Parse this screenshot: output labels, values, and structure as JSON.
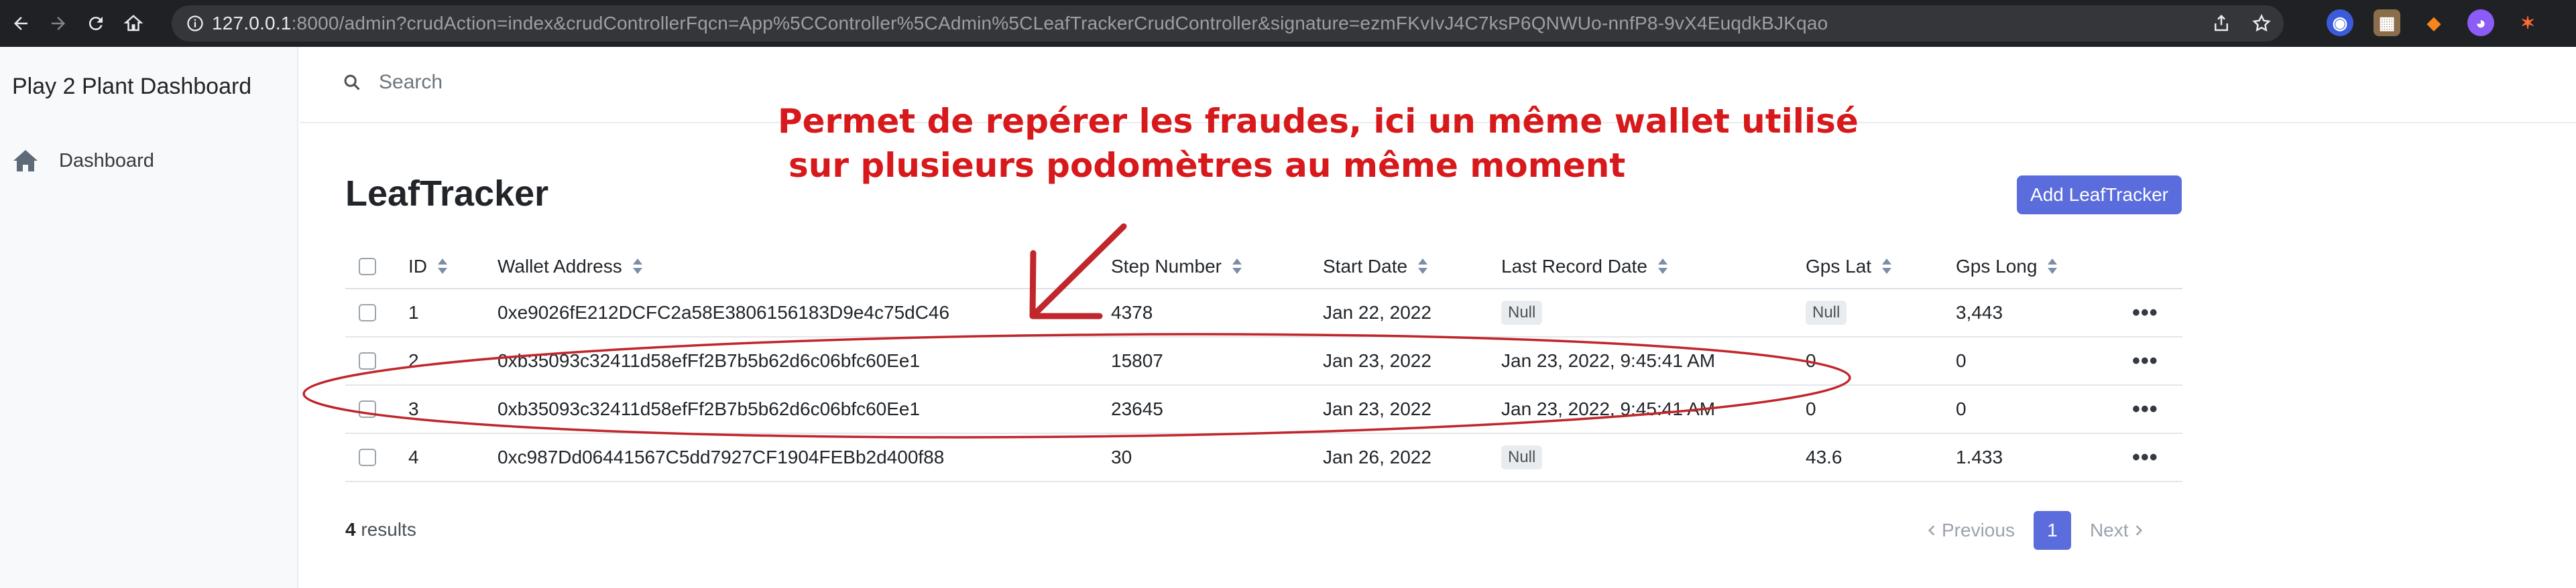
{
  "browser": {
    "url_host": "127.0.0.1",
    "url_rest": ":8000/admin?crudAction=index&crudControllerFqcn=App%5CController%5CAdmin%5CLeafTrackerCrudController&signature=ezmFKvIvJ4C7ksP6QNWUo-nnfP8-9vX4EuqdkBJKqao"
  },
  "sidebar": {
    "brand": "Play 2 Plant Dashboard",
    "items": [
      {
        "label": "Dashboard",
        "icon": "home-icon"
      }
    ]
  },
  "search": {
    "placeholder": "Search"
  },
  "page": {
    "title": "LeafTracker",
    "add_button": "Add LeafTracker",
    "accent_color": "#5b6ddc"
  },
  "annotation": {
    "line1": "Permet de repérer les fraudes, ici un même wallet utilisé",
    "line2": "sur plusieurs podomètres au même moment",
    "color": "#d7191c"
  },
  "table": {
    "columns": [
      "ID",
      "Wallet Address",
      "Step Number",
      "Start Date",
      "Last Record Date",
      "Gps Lat",
      "Gps Long"
    ],
    "rows": [
      {
        "id": "1",
        "wallet": "0xe9026fE212DCFC2a58E3806156183D9e4c75dC46",
        "step": "4378",
        "start": "Jan 22, 2022",
        "last": "Null",
        "lat": "Null",
        "long": "3,443"
      },
      {
        "id": "2",
        "wallet": "0xb35093c32411d58efFf2B7b5b62d6c06bfc60Ee1",
        "step": "15807",
        "start": "Jan 23, 2022",
        "last": "Jan 23, 2022, 9:45:41 AM",
        "lat": "0",
        "long": "0"
      },
      {
        "id": "3",
        "wallet": "0xb35093c32411d58efFf2B7b5b62d6c06bfc60Ee1",
        "step": "23645",
        "start": "Jan 23, 2022",
        "last": "Jan 23, 2022, 9:45:41 AM",
        "lat": "0",
        "long": "0"
      },
      {
        "id": "4",
        "wallet": "0xc987Dd06441567C5dd7927CF1904FEBb2d400f88",
        "step": "30",
        "start": "Jan 26, 2022",
        "last": "Null",
        "lat": "43.6",
        "long": "1.433"
      }
    ],
    "actions_glyph": "•••"
  },
  "footer": {
    "results_count": "4",
    "results_label": "results",
    "prev_label": "Previous",
    "current_page": "1",
    "next_label": "Next"
  }
}
